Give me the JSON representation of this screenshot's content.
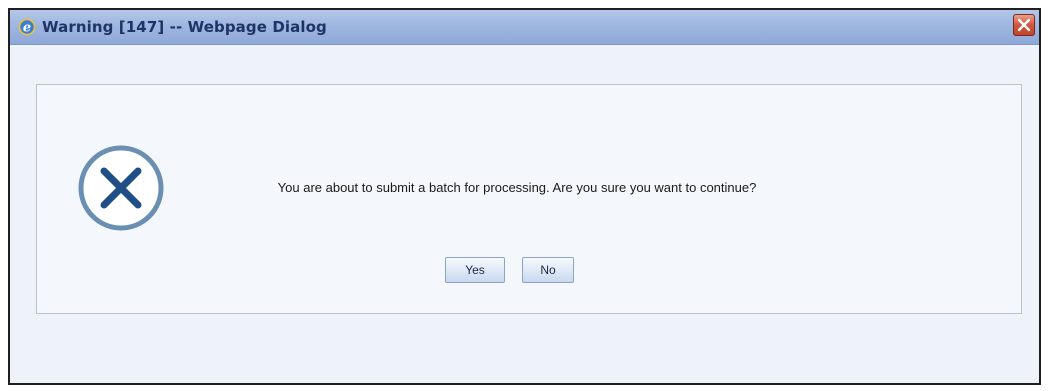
{
  "window": {
    "title": "Warning [147] -- Webpage Dialog",
    "app_icon": "internet-explorer-icon",
    "close_icon": "close-icon"
  },
  "dialog": {
    "icon": "error-circle-x-icon",
    "message": "You are about to submit a batch for processing. Are you sure you want to continue?",
    "buttons": {
      "yes_label": "Yes",
      "no_label": "No"
    }
  },
  "colors": {
    "titlebar": "#9fb6e0",
    "title_text": "#1e3466",
    "close_button": "#d2553b",
    "panel_background": "#f4f8fd",
    "icon_stroke": "#6b8fb3",
    "icon_x": "#1f4f86"
  }
}
